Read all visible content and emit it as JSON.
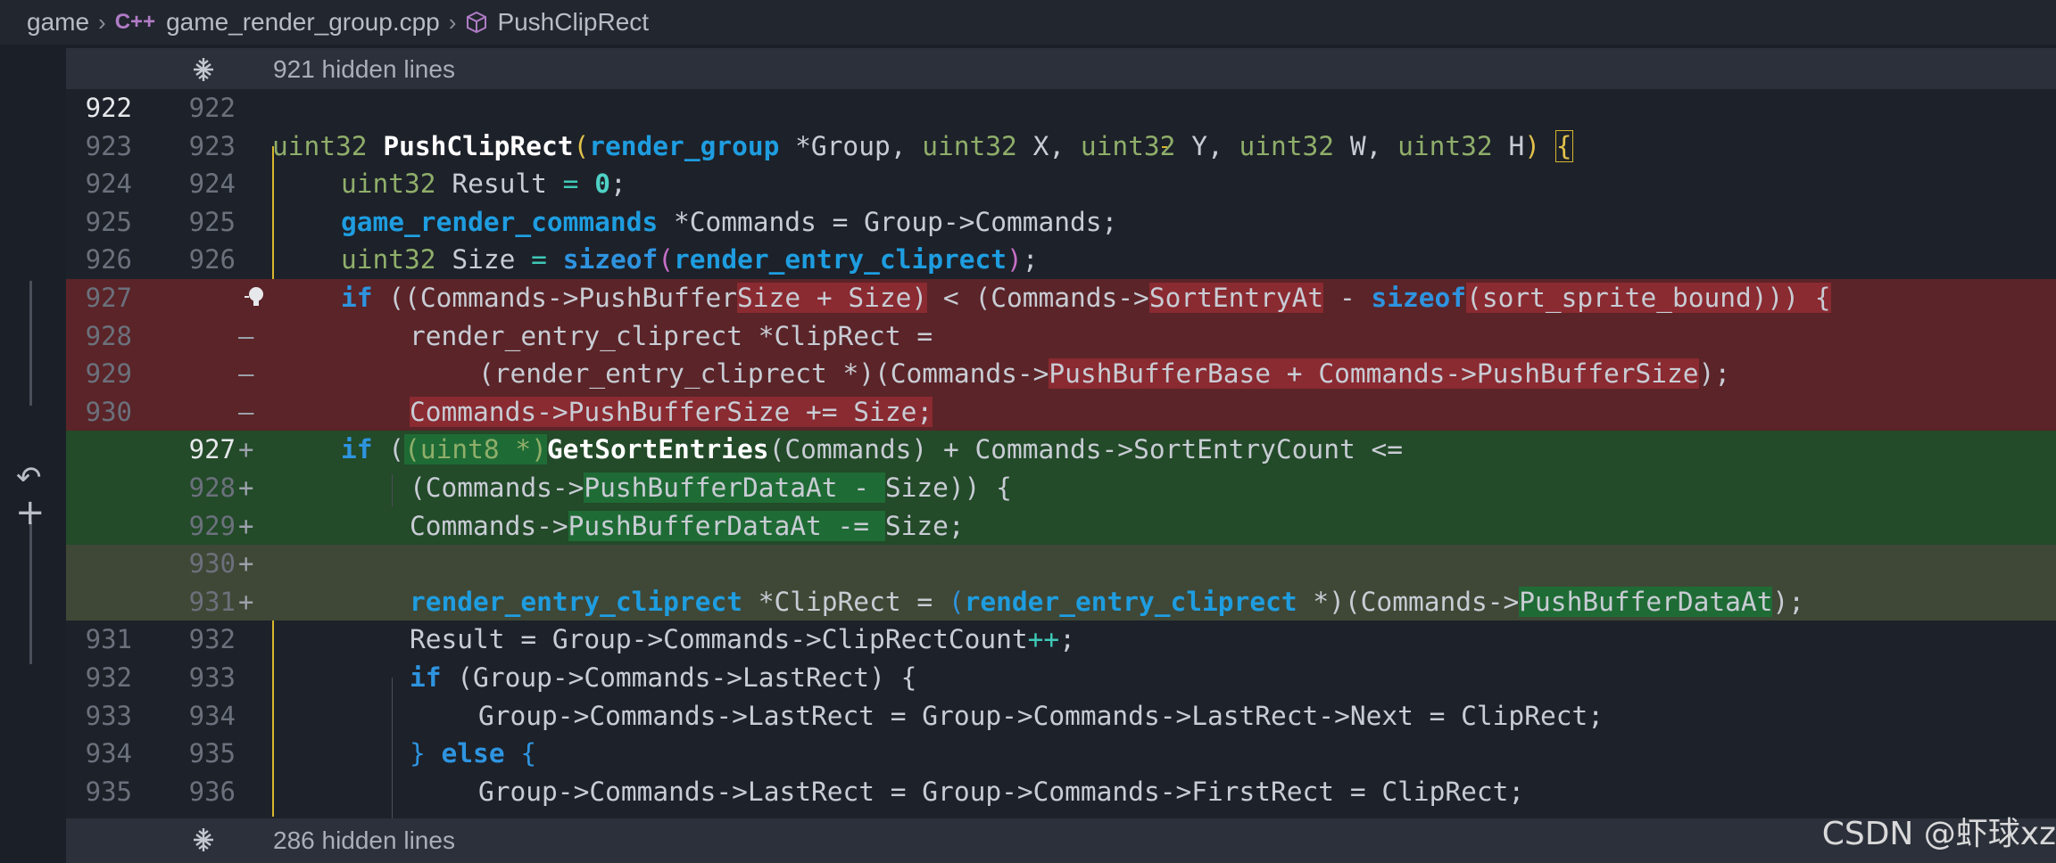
{
  "breadcrumb": {
    "folder": "game",
    "file_lang_icon": "C++",
    "file": "game_render_group.cpp",
    "symbol_icon": "cube-symbol-icon",
    "symbol": "PushClipRect"
  },
  "hidden_top": {
    "text": "921 hidden lines",
    "icon": "unfold-icon"
  },
  "hidden_bottom": {
    "text": "286 hidden lines",
    "icon": "unfold-icon"
  },
  "gutter": {
    "undo_icon": "undo-icon",
    "expand_icon": "plus-icon"
  },
  "lines": [
    {
      "l": "922",
      "r": "922",
      "mk": "",
      "kind": "ctx"
    },
    {
      "l": "923",
      "r": "923",
      "mk": "",
      "kind": "ctx"
    },
    {
      "l": "924",
      "r": "924",
      "mk": "",
      "kind": "ctx"
    },
    {
      "l": "925",
      "r": "925",
      "mk": "",
      "kind": "ctx"
    },
    {
      "l": "926",
      "r": "926",
      "mk": "",
      "kind": "ctx"
    },
    {
      "l": "927",
      "r": "",
      "mk": "",
      "kind": "del"
    },
    {
      "l": "928",
      "r": "",
      "mk": "—",
      "kind": "del"
    },
    {
      "l": "929",
      "r": "",
      "mk": "—",
      "kind": "del"
    },
    {
      "l": "930",
      "r": "",
      "mk": "—",
      "kind": "del"
    },
    {
      "l": "",
      "r": "927",
      "mk": "+",
      "kind": "add"
    },
    {
      "l": "",
      "r": "928",
      "mk": "+",
      "kind": "add"
    },
    {
      "l": "",
      "r": "929",
      "mk": "+",
      "kind": "add"
    },
    {
      "l": "",
      "r": "930",
      "mk": "+",
      "kind": "addlight"
    },
    {
      "l": "",
      "r": "931",
      "mk": "+",
      "kind": "addlight"
    },
    {
      "l": "931",
      "r": "932",
      "mk": "",
      "kind": "ctx"
    },
    {
      "l": "932",
      "r": "933",
      "mk": "",
      "kind": "ctx"
    },
    {
      "l": "933",
      "r": "934",
      "mk": "",
      "kind": "ctx"
    },
    {
      "l": "934",
      "r": "935",
      "mk": "",
      "kind": "ctx"
    },
    {
      "l": "935",
      "r": "936",
      "mk": "",
      "kind": "ctx"
    }
  ],
  "code": {
    "c923_ty1": "uint32",
    "c923_fn": "PushClipRect",
    "c923_p1": "(",
    "c923_st": "render_group",
    "c923_a": " *Group, ",
    "c923_ty2": "uint32",
    "c923_b": " X, ",
    "c923_ty3": "uint32",
    "c923_c": " Y, ",
    "c923_ty4": "uint32",
    "c923_d": " W, ",
    "c923_ty5": "uint32",
    "c923_e": " H",
    "c923_p2": ")",
    "c923_br": "{",
    "c924_ty": "uint32",
    "c924_a": " Result ",
    "c924_op": "=",
    "c924_nm": "0",
    "c924_b": ";",
    "c925_st": "game_render_commands",
    "c925_a": " *Commands = Group->Commands;",
    "c926_ty": "uint32",
    "c926_a": " Size ",
    "c926_op": "=",
    "c926_kw": "sizeof",
    "c926_p": "(",
    "c926_st": "render_entry_cliprect",
    "c926_p2": ")",
    "c926_b": ";",
    "c927_kw": "if",
    "c927_a": " ((Commands->PushBuffer",
    "c927_h1": "Size + Size)",
    "c927_b": " < (Commands->",
    "c927_h2": "SortEntryAt",
    "c927_c": " - ",
    "c927_kw2": "sizeof",
    "c927_h3": "(sort_sprite_bound))) {",
    "c928_a": "render_entry_cliprect *ClipRect =",
    "c929_a": "(render_entry_cliprect *)(Commands->",
    "c929_h": "PushBufferBase + Commands->PushBufferSize",
    ");": "",
    "c929_b": ");",
    "c930_h": "Commands->PushBufferSize += Size;",
    "a927_kw": "if",
    "a927_a": " (",
    "a927_ty": "(uint8 *)",
    "a927_fn": "GetSortEntries",
    "a927_b": "(Commands) + Commands->SortEntryCount <=",
    "a928_a": "(Commands->",
    "a928_h": "PushBufferDataAt - ",
    "a928_b": "Size)) {",
    "a929_a": "Commands->",
    "a929_h": "PushBufferDataAt -= ",
    "a929_b": "Size;",
    "a931_st": "render_entry_cliprect",
    "a931_a": " *ClipRect = ",
    "a931_p": "(",
    "a931_st2": "render_entry_cliprect",
    "a931_b": " *)(Commands->",
    "a931_h": "PushBufferDataAt",
    "a931_c": ");",
    "c932_a": "Result = Group->Commands->ClipRectCount",
    "c932_op": "++",
    "c932_b": ";",
    "c933_kw": "if",
    "c933_a": " (Group->Commands->LastRect) {",
    "c934_a": "Group->Commands->LastRect = Group->Commands->LastRect->Next = ClipRect;",
    "c935_a": "} ",
    "c935_kw": "else",
    "c935_b": " {",
    "c936_a": "Group->Commands->LastRect = Group->Commands->FirstRect = ClipRect;"
  },
  "watermark": "CSDN @虾球xz"
}
